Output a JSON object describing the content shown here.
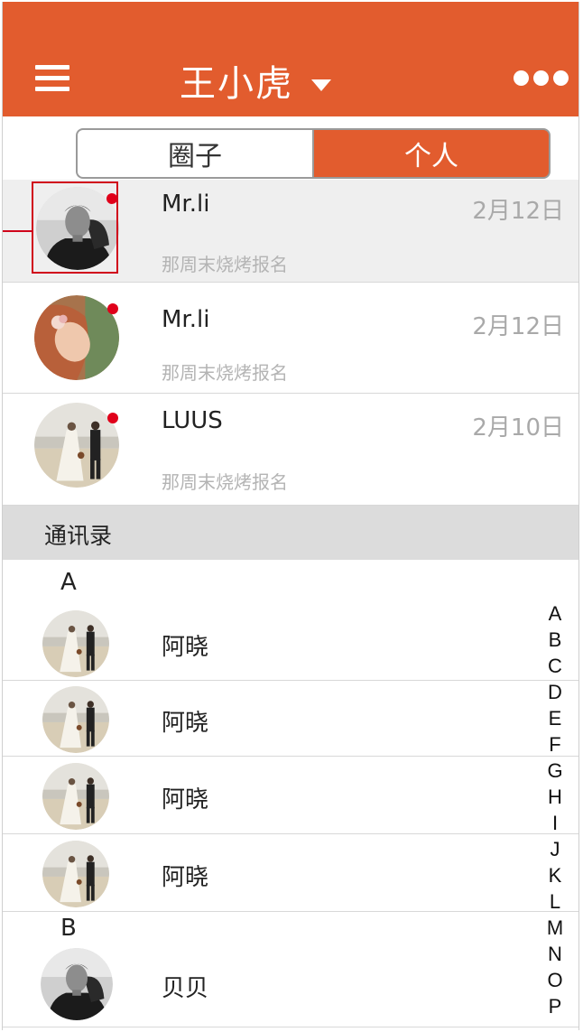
{
  "header": {
    "title": "王小虎",
    "menu_icon": "menu-icon",
    "dropdown_icon": "caret-down-icon",
    "more_icon": "more-icon",
    "bg_color": "#e25c2e"
  },
  "tabs": [
    {
      "label": "圈子",
      "active": false
    },
    {
      "label": "个人",
      "active": true
    }
  ],
  "messages": [
    {
      "name": "Mr.li",
      "date": "2月12日",
      "preview": "那周末烧烤报名",
      "unread": true,
      "avatar": "man-dark",
      "selected": true
    },
    {
      "name": "Mr.li",
      "date": "2月12日",
      "preview": "那周末烧烤报名",
      "unread": true,
      "avatar": "woman-redhair",
      "selected": false
    },
    {
      "name": "LUUS",
      "date": "2月10日",
      "preview": "那周末烧烤报名",
      "unread": true,
      "avatar": "wedding-couple",
      "selected": false
    }
  ],
  "contacts": {
    "section_label": "通讯录",
    "groups": [
      {
        "letter": "A",
        "items": [
          {
            "name": "阿晓",
            "avatar": "wedding-couple"
          },
          {
            "name": "阿晓",
            "avatar": "wedding-couple"
          },
          {
            "name": "阿晓",
            "avatar": "wedding-couple"
          },
          {
            "name": "阿晓",
            "avatar": "wedding-couple"
          }
        ]
      },
      {
        "letter": "B",
        "items": [
          {
            "name": "贝贝",
            "avatar": "man-dark"
          }
        ]
      }
    ]
  },
  "index_letters": [
    "A",
    "B",
    "C",
    "D",
    "E",
    "F",
    "G",
    "H",
    "I",
    "J",
    "K",
    "L",
    "M",
    "N",
    "O",
    "P"
  ]
}
